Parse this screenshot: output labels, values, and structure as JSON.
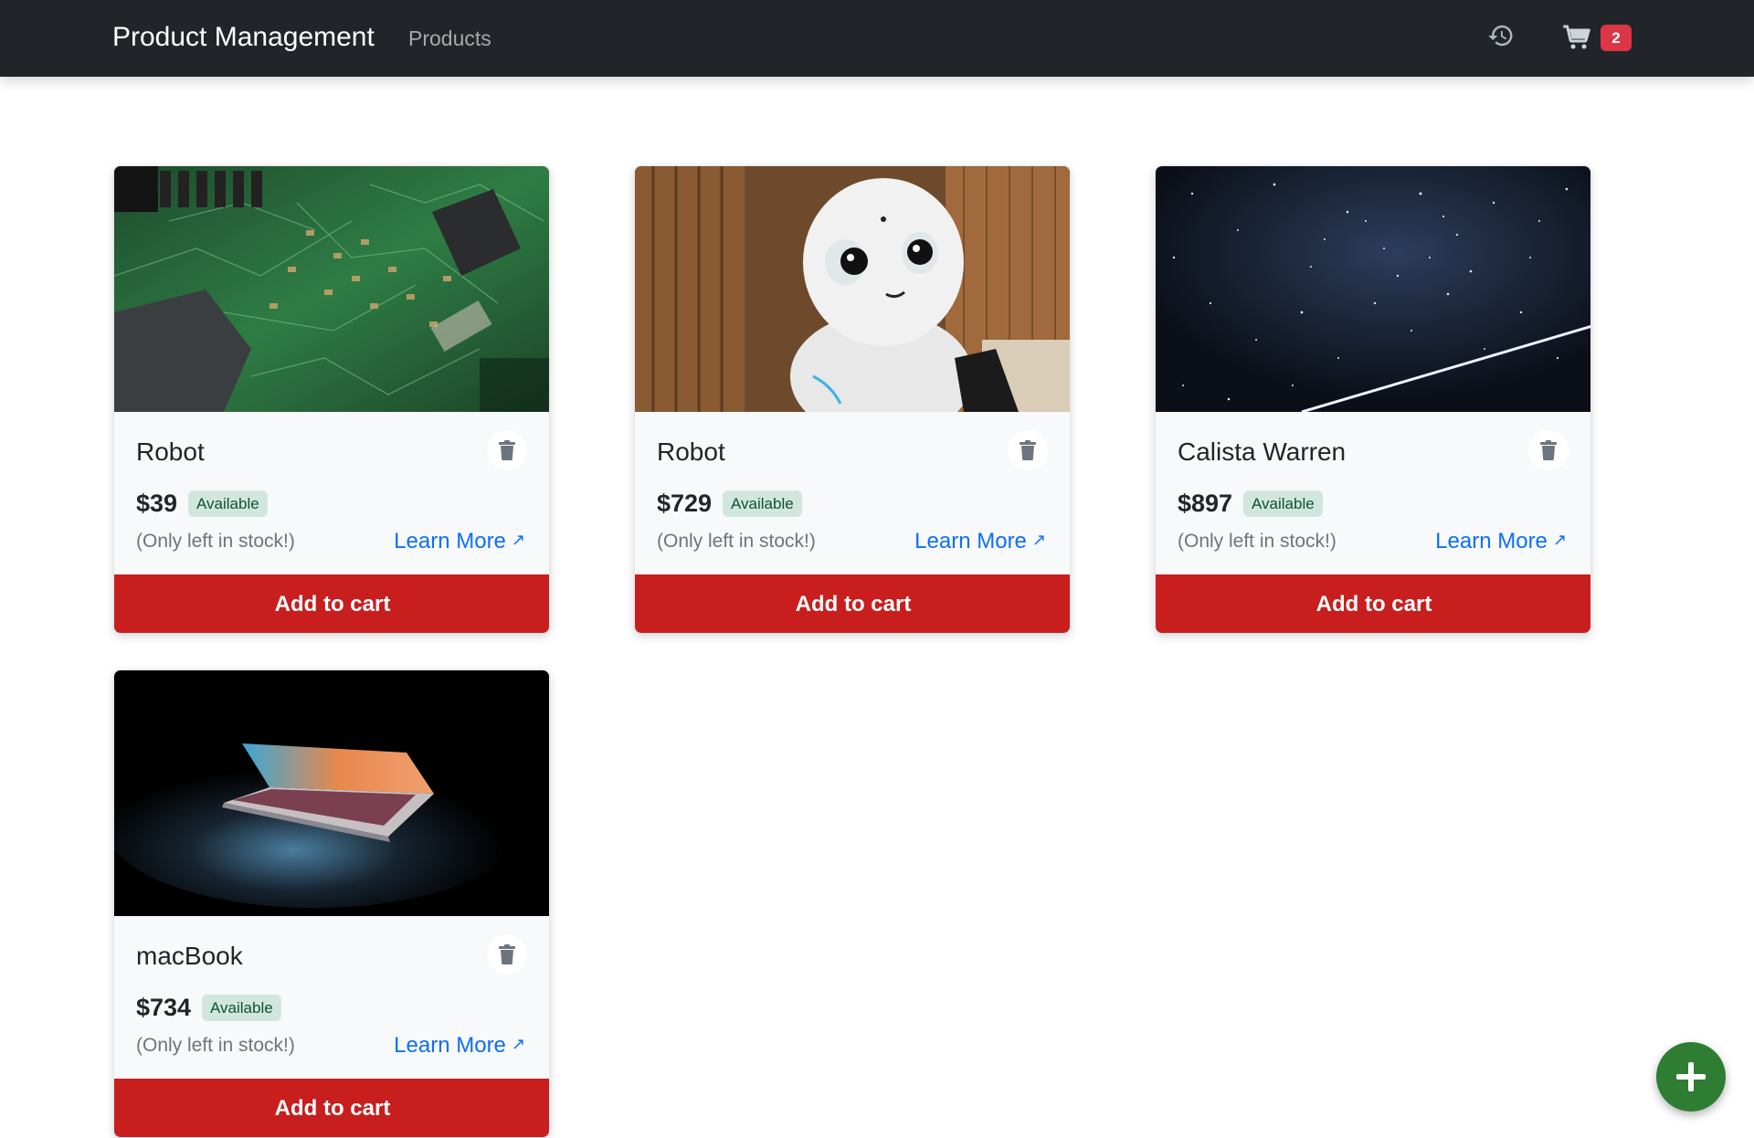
{
  "navbar": {
    "brand": "Product Management",
    "links": [
      {
        "label": "Products"
      }
    ],
    "history_icon": "history-icon",
    "cart_icon": "cart-icon",
    "cart_count": "2",
    "background": "#212529"
  },
  "products": [
    {
      "title": "Robot",
      "price": "$39",
      "status": "Available",
      "stock_text": "(Only left in stock!)",
      "learn_more": "Learn More",
      "add_to_cart": "Add to cart",
      "image": "circuit-board-photo"
    },
    {
      "title": "Robot",
      "price": "$729",
      "status": "Available",
      "stock_text": "(Only left in stock!)",
      "learn_more": "Learn More",
      "add_to_cart": "Add to cart",
      "image": "humanoid-robot-photo"
    },
    {
      "title": "Calista Warren",
      "price": "$897",
      "status": "Available",
      "stock_text": "(Only left in stock!)",
      "learn_more": "Learn More",
      "add_to_cart": "Add to cart",
      "image": "starry-sky-photo"
    },
    {
      "title": "macBook",
      "price": "$734",
      "status": "Available",
      "stock_text": "(Only left in stock!)",
      "learn_more": "Learn More",
      "add_to_cart": "Add to cart",
      "image": "laptop-dark-photo"
    }
  ],
  "fab": {
    "icon": "plus-icon"
  },
  "colors": {
    "add_to_cart": "#c81e1e",
    "badge_cart": "#dc3545",
    "badge_available_bg": "#d1e7dd",
    "badge_available_text": "#0f5132",
    "link": "#0d6efd",
    "fab": "#2e7d32"
  }
}
